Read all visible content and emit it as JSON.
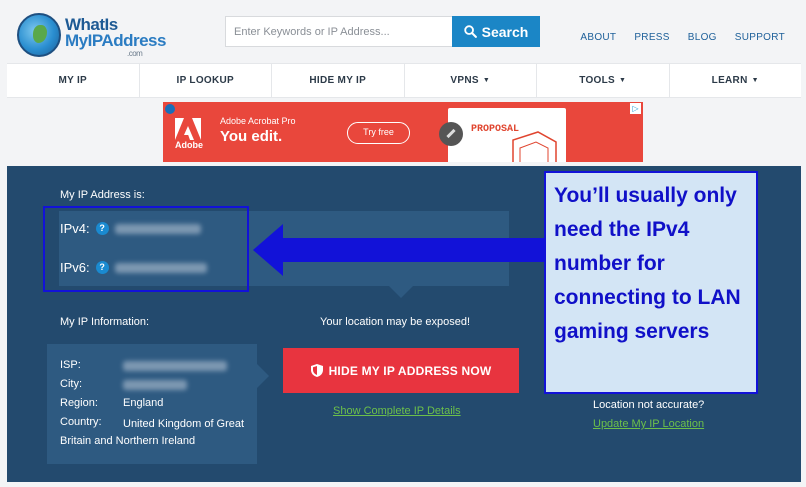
{
  "header": {
    "logo": {
      "line1": "WhatIs",
      "line2": "MyIPAddress",
      "suffix": ".com"
    },
    "search": {
      "placeholder": "Enter Keywords or IP Address...",
      "button_label": "Search"
    },
    "top_links": [
      "ABOUT",
      "PRESS",
      "BLOG",
      "SUPPORT"
    ]
  },
  "nav": {
    "items": [
      {
        "label": "MY IP",
        "dropdown": false
      },
      {
        "label": "IP LOOKUP",
        "dropdown": false
      },
      {
        "label": "HIDE MY IP",
        "dropdown": false
      },
      {
        "label": "VPNS",
        "dropdown": true
      },
      {
        "label": "TOOLS",
        "dropdown": true
      },
      {
        "label": "LEARN",
        "dropdown": true
      }
    ]
  },
  "ad": {
    "brand": "Adobe",
    "product": "Adobe Acrobat Pro",
    "headline": "You edit.",
    "cta": "Try free",
    "doc_title": "PROPOSAL"
  },
  "ip_panel": {
    "title": "My IP Address is:",
    "ipv4_label": "IPv4:",
    "ipv6_label": "IPv6:",
    "help": "?",
    "info_title": "My IP Information:",
    "info": [
      {
        "key": "ISP:",
        "value": ""
      },
      {
        "key": "City:",
        "value": ""
      },
      {
        "key": "Region:",
        "value": "England"
      },
      {
        "key": "Country:",
        "value": "United Kingdom of Great Britain and Northern Ireland"
      }
    ],
    "exposed_text": "Your location may be exposed!",
    "hide_button": "HIDE MY IP ADDRESS NOW",
    "show_details": "Show Complete IP Details",
    "location_question": "Location not accurate?",
    "update_location": "Update My IP Location"
  },
  "callout": {
    "text": "You’ll usually only need the IPv4 number for connecting to LAN gaming servers"
  },
  "colors": {
    "panel_bg": "#234a6e",
    "accent_blue": "#1b86c6",
    "hide_red": "#e8343f",
    "link_green": "#6cc04a",
    "annotation_blue": "#1212d8"
  }
}
